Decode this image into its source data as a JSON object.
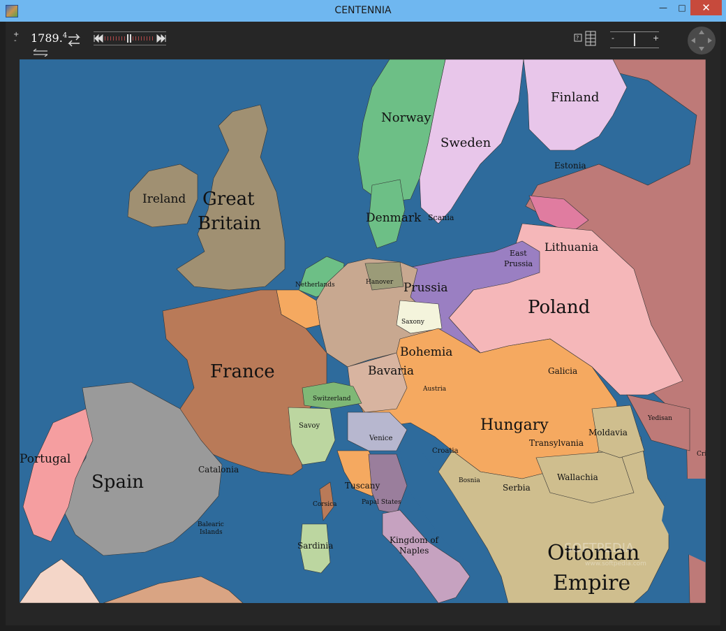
{
  "window": {
    "title": "CENTENNIA",
    "minimize_glyph": "—",
    "maximize_glyph": "□",
    "close_glyph": "✕"
  },
  "toolbar": {
    "year": "1789.",
    "year_fraction": "4",
    "zoom_minus": "-",
    "zoom_plus": "+",
    "step_plus": "+",
    "step_minus": "-"
  },
  "map": {
    "labels": {
      "norway": "Norway",
      "sweden": "Sweden",
      "finland": "Finland",
      "estonia": "Estonia",
      "ireland": "Ireland",
      "great": "Great",
      "britain": "Britain",
      "denmark": "Denmark",
      "scania": "Scania",
      "lithuania": "Lithuania",
      "east": "East",
      "prussia_east": "Prussia",
      "prussia": "Prussia",
      "poland": "Poland",
      "hanover": "Hanover",
      "netherlands": "Netherlands",
      "saxony": "Saxony",
      "bohemia": "Bohemia",
      "bavaria": "Bavaria",
      "austria": "Austria",
      "galicia": "Galicia",
      "france": "France",
      "switzerland": "Switzerland",
      "hungary": "Hungary",
      "savoy": "Savoy",
      "venice": "Venice",
      "croatia": "Croatia",
      "transylvania": "Transylvania",
      "moldavia": "Moldavia",
      "yedisan": "Yedisan",
      "portugal": "Portugal",
      "spain": "Spain",
      "catalonia": "Catalonia",
      "corsica": "Corsica",
      "tuscany": "Tuscany",
      "papal": "Papal States",
      "wallachia": "Wallachia",
      "bosnia": "Bosnia",
      "serbia": "Serbia",
      "balearic1": "Balearic",
      "balearic2": "Islands",
      "sardinia": "Sardinia",
      "kingdom1": "Kingdom of",
      "kingdom2": "Naples",
      "ottoman1": "Ottoman",
      "ottoman2": "Empire",
      "crimea": "Cri"
    }
  },
  "watermark": {
    "line1": "SOFTPEDIA",
    "line2": "www.softpedia.com"
  },
  "colors": {
    "sea": "#2e6b9c",
    "norway": "#6dbf86",
    "sweden": "#e8c6ea",
    "finland": "#e8c6ea",
    "russia": "#be7a78",
    "poland": "#f5b7b9",
    "prussia": "#9a7fc2",
    "britain": "#a09072",
    "france": "#b97a58",
    "spain": "#9a9a9a",
    "portugal": "#f59ea0",
    "austria": "#f5a960",
    "ottoman": "#cfbe8e",
    "saxony": "#f4f4dc",
    "papal": "#9a7e9c",
    "naples": "#c6a2c0"
  }
}
